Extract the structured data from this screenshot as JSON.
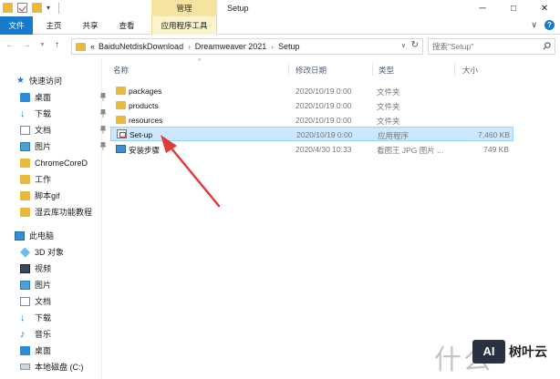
{
  "window": {
    "title": "Setup",
    "contextual_tab_header": "管理",
    "min_glyph": "─",
    "max_glyph": "□",
    "close_glyph": "✕"
  },
  "ribbon": {
    "tabs": [
      "文件",
      "主页",
      "共享",
      "查看",
      "应用程序工具"
    ],
    "expand_glyph": "∨"
  },
  "address": {
    "crumbs": [
      "BaiduNetdiskDownload",
      "Dreamweaver 2021",
      "Setup"
    ],
    "prefix": "«",
    "separator": "›",
    "search_placeholder": "搜索\"Setup\""
  },
  "sidebar": {
    "quick_access": "快速访问",
    "quick_items": [
      "桌面",
      "下载",
      "文档",
      "图片",
      "ChromeCoreD",
      "工作",
      "脚本gif",
      "湿云库功能教程"
    ],
    "this_pc": "此电脑",
    "pc_items": [
      "3D 对象",
      "视频",
      "图片",
      "文档",
      "下载",
      "音乐",
      "桌面",
      "本地磁盘 (C:)"
    ]
  },
  "columns": {
    "name": "名称",
    "date": "修改日期",
    "type": "类型",
    "size": "大小"
  },
  "files": [
    {
      "name": "packages",
      "date": "2020/10/19 0:00",
      "type": "文件夹",
      "size": "",
      "icon": "folder-icon"
    },
    {
      "name": "products",
      "date": "2020/10/19 0:00",
      "type": "文件夹",
      "size": "",
      "icon": "folder-icon"
    },
    {
      "name": "resources",
      "date": "2020/10/19 0:00",
      "type": "文件夹",
      "size": "",
      "icon": "folder-icon"
    },
    {
      "name": "Set-up",
      "date": "2020/10/19 0:00",
      "type": "应用程序",
      "size": "7,460 KB",
      "icon": "setup-exe-icon",
      "selected": true
    },
    {
      "name": "安装步骤",
      "date": "2020/4/30 10:33",
      "type": "看图王 JPG 图片 ...",
      "size": "749 KB",
      "icon": "jpg-image-icon"
    }
  ],
  "colors": {
    "file_tab": "#1979ca",
    "manage_tab": "#f4e4a0",
    "selection": "#cce8ff",
    "annotation_arrow": "#e03a3a"
  },
  "watermark": {
    "left": "什么",
    "badge": "AI",
    "right": "树叶云"
  }
}
